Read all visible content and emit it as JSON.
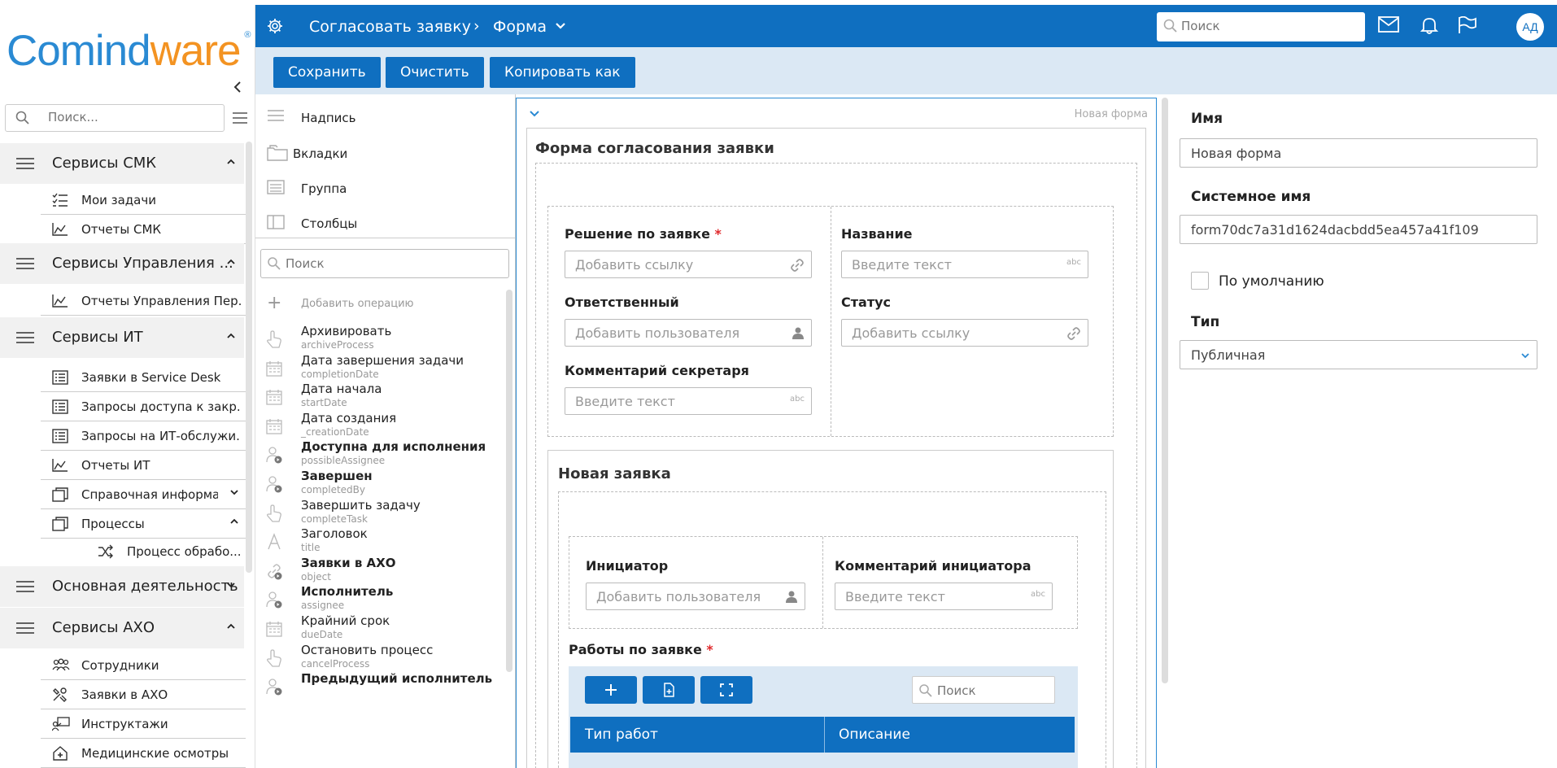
{
  "app": {
    "logo": {
      "part1": "Comind",
      "part2": "ware",
      "reg": "®"
    }
  },
  "sidebar": {
    "search_placeholder": "Поиск...",
    "groups": [
      {
        "label": "Сервисы СМК",
        "chevron": "^"
      },
      {
        "label": "Сервисы Управления ...",
        "chevron": "^"
      },
      {
        "label": "Сервисы ИТ",
        "chevron": "^"
      },
      {
        "label": "Основная деятельность",
        "chevron": "v"
      },
      {
        "label": "Сервисы АХО",
        "chevron": "^"
      }
    ],
    "items": [
      {
        "label": "Мои задачи",
        "icon": "tasks-icon"
      },
      {
        "label": "Отчеты СМК",
        "icon": "chart-icon"
      },
      {
        "label": "Отчеты Управления Пер...",
        "icon": "chart-icon"
      },
      {
        "label": "Заявки в Service Desk",
        "icon": "list-icon"
      },
      {
        "label": "Запросы доступа к закр...",
        "icon": "list-icon"
      },
      {
        "label": "Запросы на ИТ-обслужи...",
        "icon": "list-icon"
      },
      {
        "label": "Отчеты ИТ",
        "icon": "chart-icon"
      },
      {
        "label": "Справочная информа...",
        "icon": "folder-icon"
      },
      {
        "label": "Процессы",
        "icon": "folder-icon"
      },
      {
        "label": "Процесс обрабо...",
        "icon": "shuffle-icon"
      },
      {
        "label": "Сотрудники",
        "icon": "people-icon"
      },
      {
        "label": "Заявки в АХО",
        "icon": "tools-icon"
      },
      {
        "label": "Инструктажи",
        "icon": "instruct-icon"
      },
      {
        "label": "Медицинские осмотры",
        "icon": "medical-icon"
      }
    ]
  },
  "header": {
    "breadcrumb1": "Согласовать заявку",
    "breadcrumb_sep": "›",
    "breadcrumb2": "Форма",
    "search_placeholder": "Поиск",
    "avatar": "АД"
  },
  "toolbar": {
    "save": "Сохранить",
    "clear": "Очистить",
    "copy_as": "Копировать как"
  },
  "palette": {
    "elements": [
      "Надпись",
      "Вкладки",
      "Группа",
      "Столбцы"
    ],
    "search_placeholder": "Поиск",
    "add_operation": "Добавить операцию",
    "operations": [
      {
        "title": "Архивировать",
        "sub": "archiveProcess",
        "bold": false,
        "icon": "hand-icon"
      },
      {
        "title": "Дата завершения задачи",
        "sub": "completionDate",
        "bold": false,
        "icon": "calendar-icon"
      },
      {
        "title": "Дата начала",
        "sub": "startDate",
        "bold": false,
        "icon": "calendar-icon"
      },
      {
        "title": "Дата создания",
        "sub": "_creationDate",
        "bold": false,
        "icon": "calendar-icon"
      },
      {
        "title": "Доступна для исполнения",
        "sub": "possibleAssignee",
        "bold": true,
        "icon": "user-icon"
      },
      {
        "title": "Завершен",
        "sub": "completedBy",
        "bold": true,
        "icon": "user-icon"
      },
      {
        "title": "Завершить задачу",
        "sub": "completeTask",
        "bold": false,
        "icon": "hand-icon"
      },
      {
        "title": "Заголовок",
        "sub": "title",
        "bold": false,
        "icon": "text-icon"
      },
      {
        "title": "Заявки в АХО",
        "sub": "object",
        "bold": true,
        "icon": "link-icon"
      },
      {
        "title": "Исполнитель",
        "sub": "assignee",
        "bold": true,
        "icon": "user-icon"
      },
      {
        "title": "Крайний срок",
        "sub": "dueDate",
        "bold": false,
        "icon": "calendar-icon"
      },
      {
        "title": "Остановить процесс",
        "sub": "cancelProcess",
        "bold": false,
        "icon": "hand-icon"
      },
      {
        "title": "Предыдущий исполнитель",
        "sub": "",
        "bold": true,
        "icon": "user-icon"
      }
    ]
  },
  "canvas": {
    "form_tag": "Новая форма",
    "form_title": "Форма согласования заявки",
    "fields": {
      "decision": {
        "label": "Решение по заявке",
        "required": "*",
        "placeholder": "Добавить ссылку"
      },
      "responsible": {
        "label": "Ответственный",
        "placeholder": "Добавить пользователя"
      },
      "secretary_comment": {
        "label": "Комментарий секретаря",
        "placeholder": "Введите текст",
        "suffix": "abc"
      },
      "name": {
        "label": "Название",
        "placeholder": "Введите текст",
        "suffix": "abc"
      },
      "status": {
        "label": "Статус",
        "placeholder": "Добавить ссылку"
      }
    },
    "section2": {
      "title": "Новая заявка",
      "initiator": {
        "label": "Инициатор",
        "placeholder": "Добавить пользователя"
      },
      "initiator_comment": {
        "label": "Комментарий инициатора",
        "placeholder": "Введите текст",
        "suffix": "abc"
      },
      "works": {
        "label": "Работы по заявке",
        "required": "*",
        "search_placeholder": "Поиск",
        "columns": [
          "Тип работ",
          "Описание"
        ]
      }
    }
  },
  "properties": {
    "name_label": "Имя",
    "name_value": "Новая форма",
    "sysname_label": "Системное имя",
    "sysname_value": "form70dc7a31d1624dacbdd5ea457a41f109",
    "default_label": "По умолчанию",
    "default_checked": false,
    "type_label": "Тип",
    "type_value": "Публичная"
  },
  "colors": {
    "primary": "#0f6fc0",
    "toolbar_bg": "#dbe8f4",
    "logo_blue": "#2a8ad3",
    "logo_orange": "#f39322",
    "required": "#e0292c"
  }
}
